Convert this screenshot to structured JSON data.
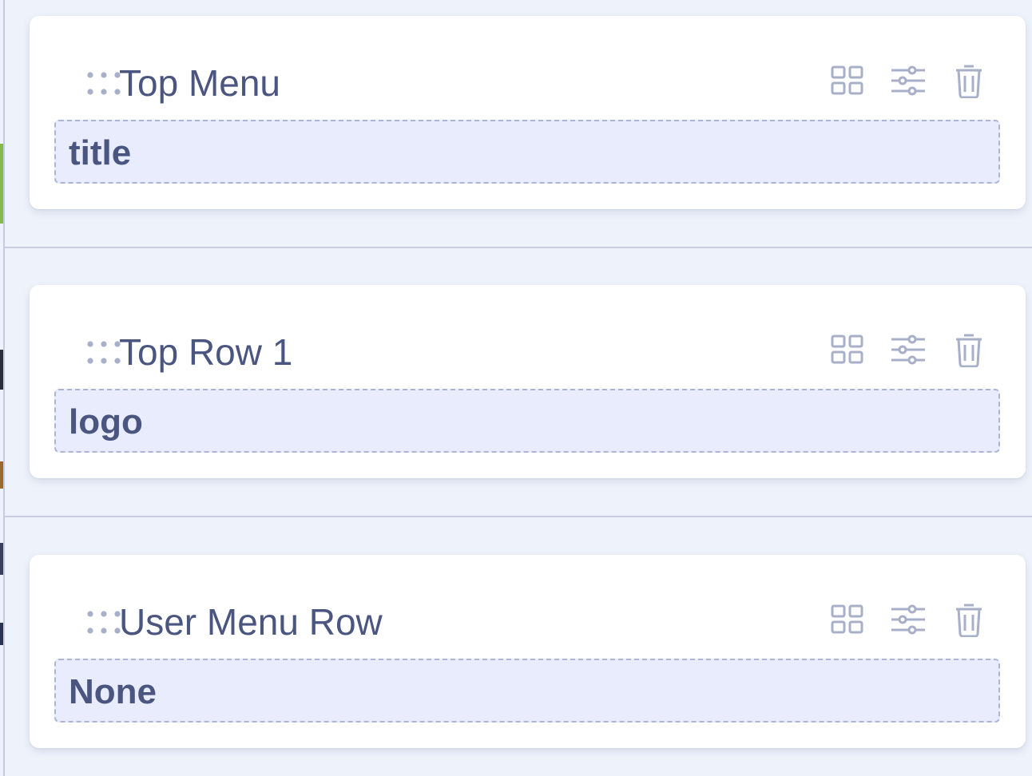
{
  "cards": [
    {
      "title": "Top Menu",
      "slot": "title"
    },
    {
      "title": "Top Row 1",
      "slot": "logo"
    },
    {
      "title": "User Menu Row",
      "slot": "None"
    }
  ],
  "icons": {
    "drag": "drag-handle-icon",
    "layout": "grid-layout-icon",
    "settings": "sliders-icon",
    "delete": "trash-icon"
  },
  "colors": {
    "background": "#eef2fb",
    "card": "#ffffff",
    "text": "#4a5580",
    "slot_fill": "#e8ecfd",
    "slot_border": "#aeb5d4",
    "icon": "#a8afc8"
  }
}
